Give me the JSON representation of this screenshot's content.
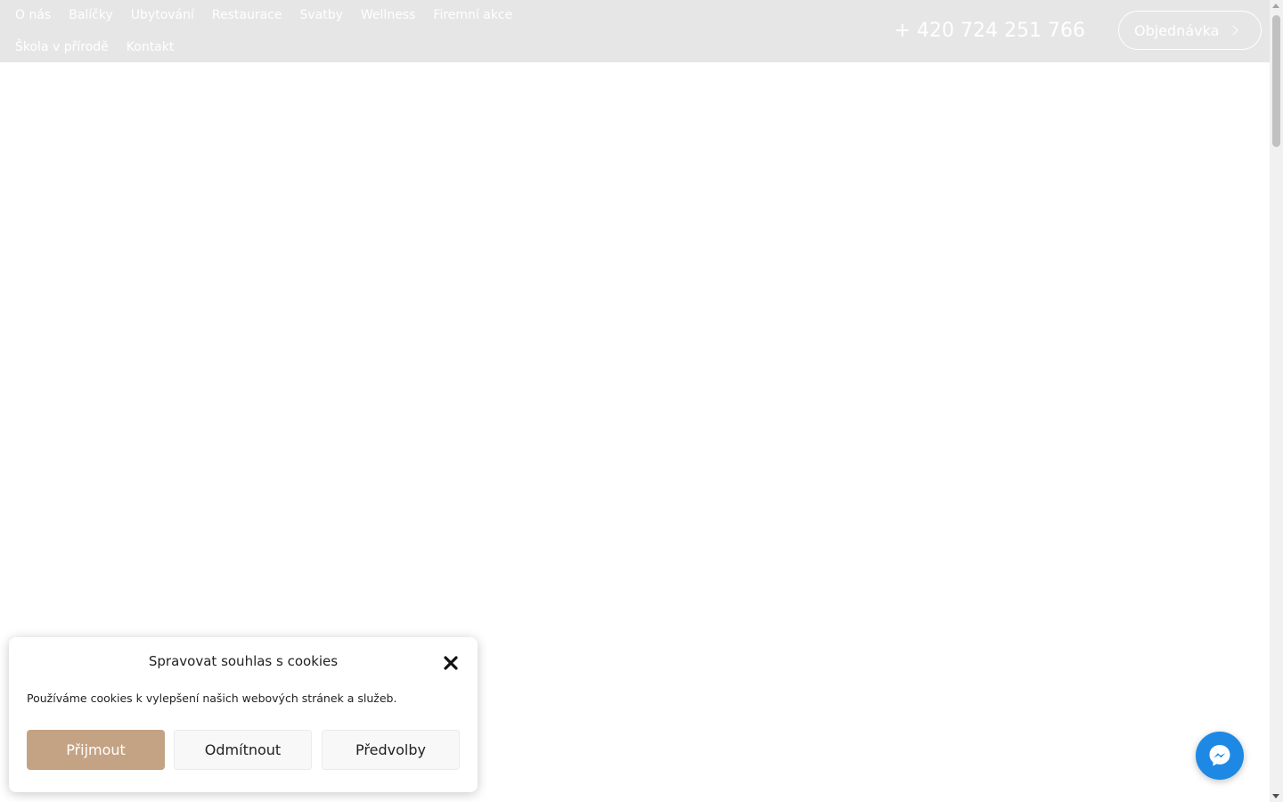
{
  "nav": {
    "row1": [
      "O nás",
      "Balíčky",
      "Ubytování",
      "Restaurace",
      "Svatby",
      "Wellness",
      "Firemní akce"
    ],
    "row2": [
      "Škola v přírodě",
      "Kontakt"
    ]
  },
  "header": {
    "phone": "+ 420 724 251 766",
    "order_label": "Objednávka"
  },
  "cookie": {
    "title": "Spravovat souhlas s cookies",
    "text": "Používáme cookies k vylepšení našich webových stránek a služeb.",
    "accept_label": "Přijmout",
    "deny_label": "Odmítnout",
    "prefs_label": "Předvolby"
  },
  "icons": {
    "close": "close-icon",
    "messenger": "messenger-icon",
    "chevron": "chevron-right-icon"
  },
  "colors": {
    "header_bg": "#e6e6e6",
    "accent": "#c4a384",
    "messenger": "#1e88e5"
  }
}
